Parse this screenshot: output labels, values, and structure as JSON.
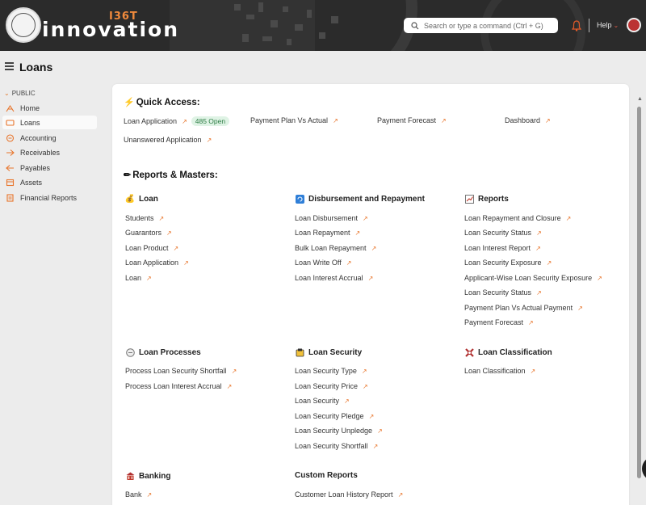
{
  "brand": {
    "name": "innovation",
    "tag": "I36T"
  },
  "search": {
    "placeholder": "Search or type a command (Ctrl + G)"
  },
  "navbar": {
    "help_label": "Help"
  },
  "page": {
    "title": "Loans"
  },
  "sidebar": {
    "group_label": "PUBLIC",
    "items": [
      {
        "label": "Home",
        "icon": "home-icon"
      },
      {
        "label": "Loans",
        "icon": "loans-icon"
      },
      {
        "label": "Accounting",
        "icon": "accounting-icon"
      },
      {
        "label": "Receivables",
        "icon": "receivables-icon"
      },
      {
        "label": "Payables",
        "icon": "payables-icon"
      },
      {
        "label": "Assets",
        "icon": "assets-icon"
      },
      {
        "label": "Financial Reports",
        "icon": "financial-reports-icon"
      }
    ]
  },
  "quick_access": {
    "title": "Quick Access:",
    "items": [
      {
        "label": "Loan Application",
        "badge": "485 Open"
      },
      {
        "label": "Payment Plan Vs Actual"
      },
      {
        "label": "Payment Forecast"
      },
      {
        "label": "Dashboard"
      },
      {
        "label": "Unanswered Application"
      }
    ]
  },
  "reports": {
    "title": "Reports & Masters:",
    "groups": [
      {
        "title": "Loan",
        "icon": "money-bag-icon",
        "links": [
          "Students",
          "Guarantors",
          "Loan Product",
          "Loan Application",
          "Loan"
        ]
      },
      {
        "title": "Disbursement and Repayment",
        "icon": "refresh-icon",
        "links": [
          "Loan Disbursement",
          "Loan Repayment",
          "Bulk Loan Repayment",
          "Loan Write Off",
          "Loan Interest Accrual"
        ]
      },
      {
        "title": "Reports",
        "icon": "chart-icon",
        "links": [
          "Loan Repayment and Closure",
          "Loan Security Status",
          "Loan Interest Report",
          "Loan Security Exposure",
          "Applicant-Wise Loan Security Exposure",
          "Loan Security Status",
          "Payment Plan Vs Actual Payment",
          "Payment Forecast"
        ]
      },
      {
        "title": "Loan Processes",
        "icon": "circle-icon",
        "links": [
          "Process Loan Security Shortfall",
          "Process Loan Interest Accrual"
        ]
      },
      {
        "title": "Loan Security",
        "icon": "security-icon",
        "links": [
          "Loan Security Type",
          "Loan Security Price",
          "Loan Security",
          "Loan Security Pledge",
          "Loan Security Unpledge",
          "Loan Security Shortfall"
        ]
      },
      {
        "title": "Loan Classification",
        "icon": "classification-icon",
        "links": [
          "Loan Classification"
        ]
      },
      {
        "title": "Banking",
        "icon": "bank-icon",
        "links": [
          "Bank"
        ]
      },
      {
        "title": "Custom Reports",
        "icon": "",
        "links": [
          "Customer Loan History Report"
        ]
      }
    ]
  },
  "colors": {
    "accent": "#e8742a",
    "navbar": "#2b2b2b",
    "badge_bg": "#dff3e5",
    "badge_fg": "#2e7d45"
  }
}
